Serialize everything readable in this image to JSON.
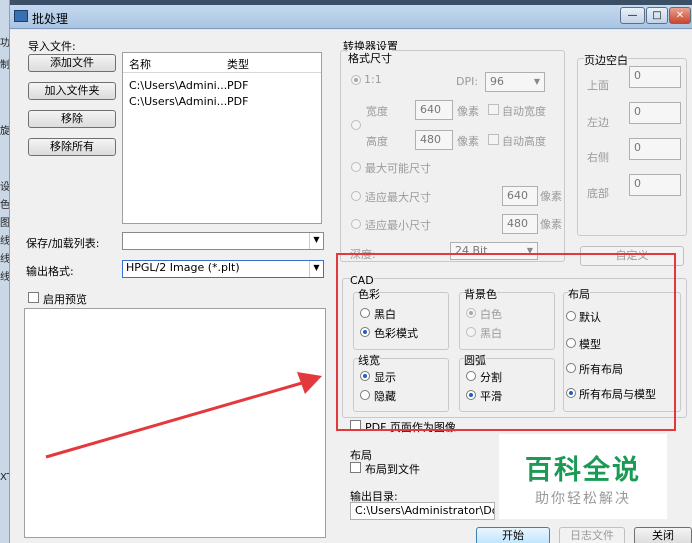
{
  "left_strip": [
    "功",
    "制",
    "旋",
    "设",
    "色",
    "图",
    "线",
    "线",
    "线",
    "XT"
  ],
  "window": {
    "title": "批处理",
    "buttons": {
      "minimize": "—",
      "maximize": "□",
      "close": "✕"
    }
  },
  "import": {
    "label": "导入文件:",
    "buttons": {
      "add_file": "添加文件",
      "add_folder": "加入文件夹",
      "remove": "移除",
      "remove_all": "移除所有"
    },
    "columns": [
      "名称",
      "类型"
    ],
    "rows": [
      {
        "name": "C:\\Users\\Admini...",
        "type": "PDF"
      },
      {
        "name": "C:\\Users\\Admini...",
        "type": "PDF"
      }
    ]
  },
  "save_list": {
    "label": "保存/加载列表:",
    "value": ""
  },
  "output_format": {
    "label": "输出格式:",
    "value": "HPGL/2 Image (*.plt)"
  },
  "preview": {
    "label": "启用预览"
  },
  "converter": {
    "section": "转换器设置",
    "size": {
      "group": "格式尺寸",
      "ratio": "1:1",
      "dpi_label": "DPI:",
      "dpi": "96",
      "width_label": "宽度",
      "width": "640",
      "height_label": "高度",
      "height": "480",
      "unit": "像素",
      "auto_width": "自动宽度",
      "auto_height": "自动高度",
      "max_possible": "最大可能尺寸",
      "fit_max": "适应最大尺寸",
      "fit_max_value": "640",
      "fit_min": "适应最小尺寸",
      "fit_min_value": "480",
      "depth_label": "深度:",
      "depth": "24 Bit"
    },
    "margins": {
      "group": "页边空白",
      "top": "上面",
      "left": "左边",
      "right": "右侧",
      "bottom": "底部",
      "top_v": "0",
      "left_v": "0",
      "right_v": "0",
      "bottom_v": "0",
      "custom": "自定义"
    },
    "cad": {
      "title": "CAD",
      "color": {
        "title": "色彩",
        "bw": "黑白",
        "color_mode": "色彩模式"
      },
      "background": {
        "title": "背景色",
        "white": "白色",
        "black": "黑白"
      },
      "layout": {
        "title": "布局",
        "default": "默认",
        "model": "模型",
        "all_layouts": "所有布局",
        "all_layouts_model": "所有布局与模型"
      },
      "lineweight": {
        "title": "线宽",
        "show": "显示",
        "hide": "隐藏"
      },
      "arc": {
        "title": "圆弧",
        "split": "分割",
        "smooth": "平滑"
      }
    },
    "pdf_as_image": "PDF 页面作为图像",
    "layout_section": {
      "title": "布局",
      "layout_to_file": "布局到文件"
    },
    "output_dir": {
      "label": "输出目录:",
      "value": "C:\\Users\\Administrator\\Docu"
    }
  },
  "footer": {
    "start": "开始",
    "log": "日志文件",
    "close": "关闭"
  },
  "watermark": {
    "title": "百科全说",
    "subtitle": "助你轻松解决"
  }
}
